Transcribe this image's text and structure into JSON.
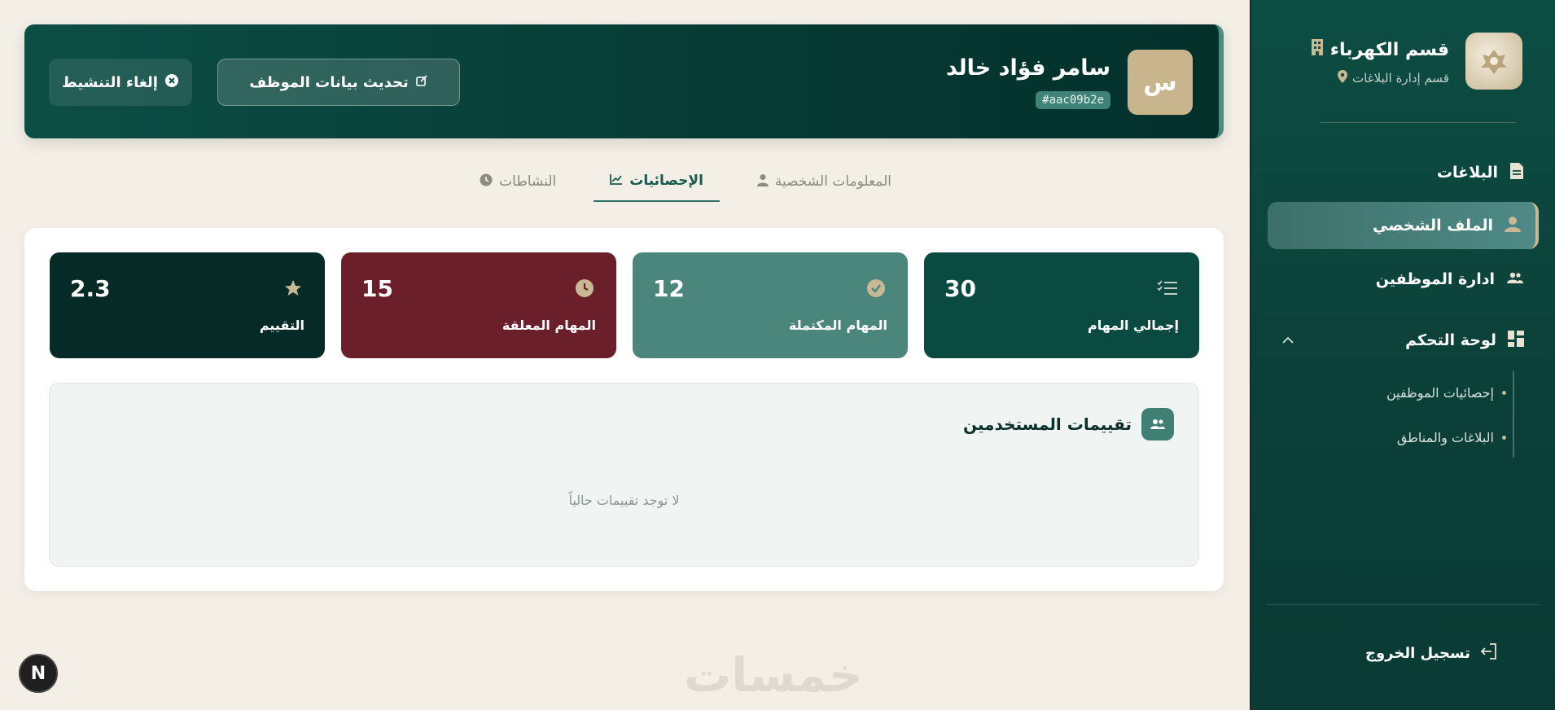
{
  "header": {
    "avatar_initial": "س",
    "employee_name": "سامر فؤاد خالد",
    "employee_id": "#aac09b2e",
    "update_button": "تحديث بيانات الموظف",
    "deactivate_button": "إلغاء التنشيط"
  },
  "tabs": [
    {
      "label": "المعلومات الشخصية",
      "icon": "user-icon"
    },
    {
      "label": "الإحصائيات",
      "icon": "chart-icon",
      "active": true
    },
    {
      "label": "النشاطات",
      "icon": "clock-icon"
    }
  ],
  "stats": [
    {
      "label": "إجمالي المهام",
      "value": "30",
      "icon": "list-check-icon",
      "color": "#0b4a41"
    },
    {
      "label": "المهام المكتملة",
      "value": "12",
      "icon": "check-circle-icon",
      "color": "#4b867c"
    },
    {
      "label": "المهام المعلقة",
      "value": "15",
      "icon": "clock-icon",
      "color": "#6b1f2a"
    },
    {
      "label": "التقييم",
      "value": "2.3",
      "icon": "star-icon",
      "color": "#062a26"
    }
  ],
  "ratings": {
    "title": "تقييمات المستخدمين",
    "empty_text": "لا توجد تقييمات حالياً"
  },
  "badge": {
    "letter": "N"
  },
  "watermark": "خمسات",
  "sidebar": {
    "dept_title": "قسم الكهرباء",
    "dept_subtitle": "قسم إدارة البلاغات",
    "items": [
      {
        "label": "البلاغات",
        "icon": "document-icon"
      },
      {
        "label": "الملف الشخصي",
        "icon": "user-icon",
        "active": true
      },
      {
        "label": "ادارة الموظفين",
        "icon": "users-icon"
      },
      {
        "label": "لوحة التحكم",
        "icon": "dashboard-icon"
      }
    ],
    "sub_items": [
      {
        "label": "إحصائيات الموظفين"
      },
      {
        "label": "البلاغات والمناطق"
      }
    ],
    "logout": "تسجيل الخروج"
  },
  "colors": {
    "primary": "#0b4a41",
    "accent_gold": "#c9b894",
    "danger": "#6b1f2a",
    "background": "#f3efe6"
  }
}
